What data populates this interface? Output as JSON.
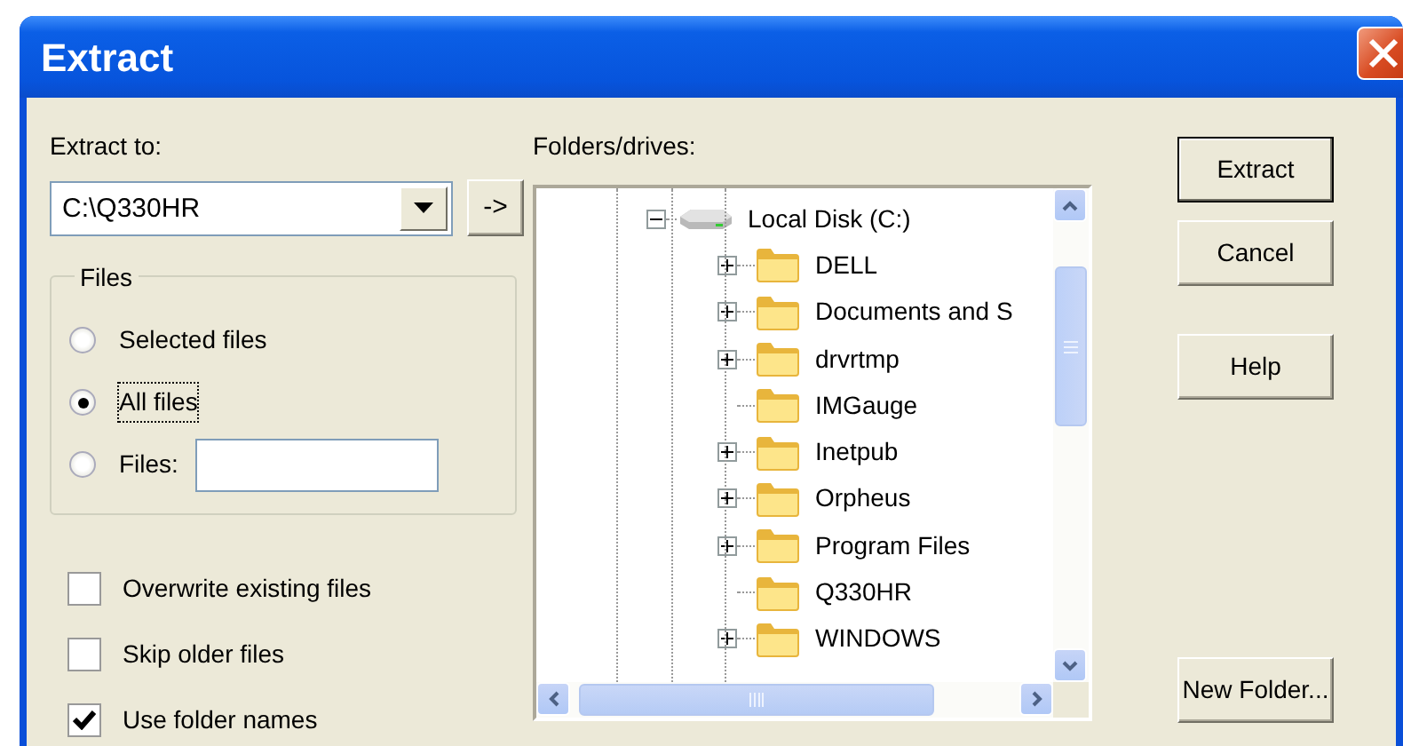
{
  "window": {
    "title": "Extract"
  },
  "extract_to": {
    "label": "Extract to:",
    "value": "C:\\Q330HR",
    "browse_button": "->"
  },
  "files_group": {
    "title": "Files",
    "options": [
      {
        "label": "Selected files",
        "selected": false,
        "focused": false
      },
      {
        "label": "All files",
        "selected": true,
        "focused": true
      },
      {
        "label": "Files:",
        "selected": false,
        "focused": false,
        "kind": "field"
      }
    ]
  },
  "checkboxes": [
    {
      "label": "Overwrite existing files",
      "checked": false
    },
    {
      "label": "Skip older files",
      "checked": false
    },
    {
      "label": "Use folder names",
      "checked": true
    }
  ],
  "folders": {
    "label": "Folders/drives:",
    "tree": [
      {
        "label": "Local Disk (C:)",
        "kind": "drive",
        "expanded": true,
        "children": [
          {
            "label": "DELL",
            "kind": "folder",
            "expandable": true
          },
          {
            "label": "Documents and S",
            "kind": "folder",
            "expandable": true
          },
          {
            "label": "drvrtmp",
            "kind": "folder",
            "expandable": true
          },
          {
            "label": "IMGauge",
            "kind": "folder",
            "expandable": false
          },
          {
            "label": "Inetpub",
            "kind": "folder",
            "expandable": true
          },
          {
            "label": "Orpheus",
            "kind": "folder",
            "expandable": true
          },
          {
            "label": "Program Files",
            "kind": "folder",
            "expandable": true
          },
          {
            "label": "Q330HR",
            "kind": "folder",
            "expandable": false
          },
          {
            "label": "WINDOWS",
            "kind": "folder",
            "expandable": true
          }
        ]
      }
    ]
  },
  "buttons": [
    {
      "label": "Extract",
      "default": true
    },
    {
      "label": "Cancel",
      "default": false
    }
  ],
  "help_button": {
    "label": "Help"
  },
  "new_folder_button": {
    "label": "New Folder..."
  }
}
